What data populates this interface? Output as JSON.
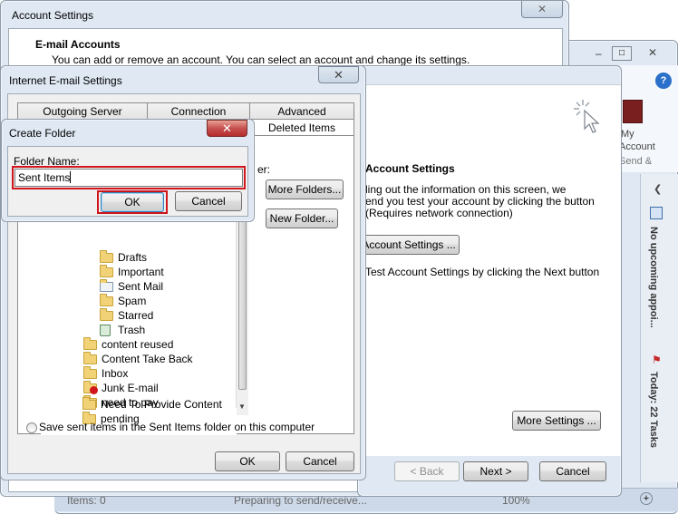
{
  "account_settings": {
    "title": "Account Settings",
    "heading": "E-mail Accounts",
    "subtext": "You can add or remove an account. You can select an account and change its settings."
  },
  "outlook_bg": {
    "status_items": "Items: 0",
    "status_sending": "Preparing to send/receive...",
    "status_zoom": "100%",
    "ribbon_my": "My",
    "ribbon_account": "Account",
    "ribbon_send": "Send &",
    "todo_appointments": "No upcoming appoi...",
    "todo_tasks": "Today: 22 Tasks"
  },
  "add_account": {
    "section_title": "Account Settings",
    "line1": "ling out the information on this screen, we",
    "line2": "end you test your account by clicking the button",
    "line3": "(Requires network connection)",
    "test_button": "Account Settings ...",
    "checkbox_label": "Test Account Settings by clicking the Next button",
    "more_settings": "More Settings ...",
    "back": "< Back",
    "next": "Next >",
    "cancel": "Cancel"
  },
  "internet_email": {
    "title": "Internet E-mail Settings",
    "tabs": [
      "Outgoing Server",
      "Connection",
      "Advanced",
      "Deleted Items"
    ],
    "folder_label_tail": "er:",
    "more_folders": "More Folders...",
    "new_folder": "New Folder...",
    "subfolders": [
      "Drafts",
      "Important",
      "Sent Mail",
      "Spam",
      "Starred",
      "Trash"
    ],
    "folders": [
      "content reused",
      "Content Take Back",
      "Inbox",
      "Junk E-mail",
      "need to pay",
      "Need To Provide Content",
      "pending"
    ],
    "radio_label": "Save sent items in the Sent Items folder on this computer",
    "ok": "OK",
    "cancel": "Cancel"
  },
  "create_folder": {
    "title": "Create Folder",
    "label": "Folder Name:",
    "value": "Sent Items",
    "ok": "OK",
    "cancel": "Cancel"
  },
  "colors": {
    "accent_red": "#d0161c",
    "window_frame": "#dfe8f3",
    "dialog_face": "#f0f0f0"
  }
}
